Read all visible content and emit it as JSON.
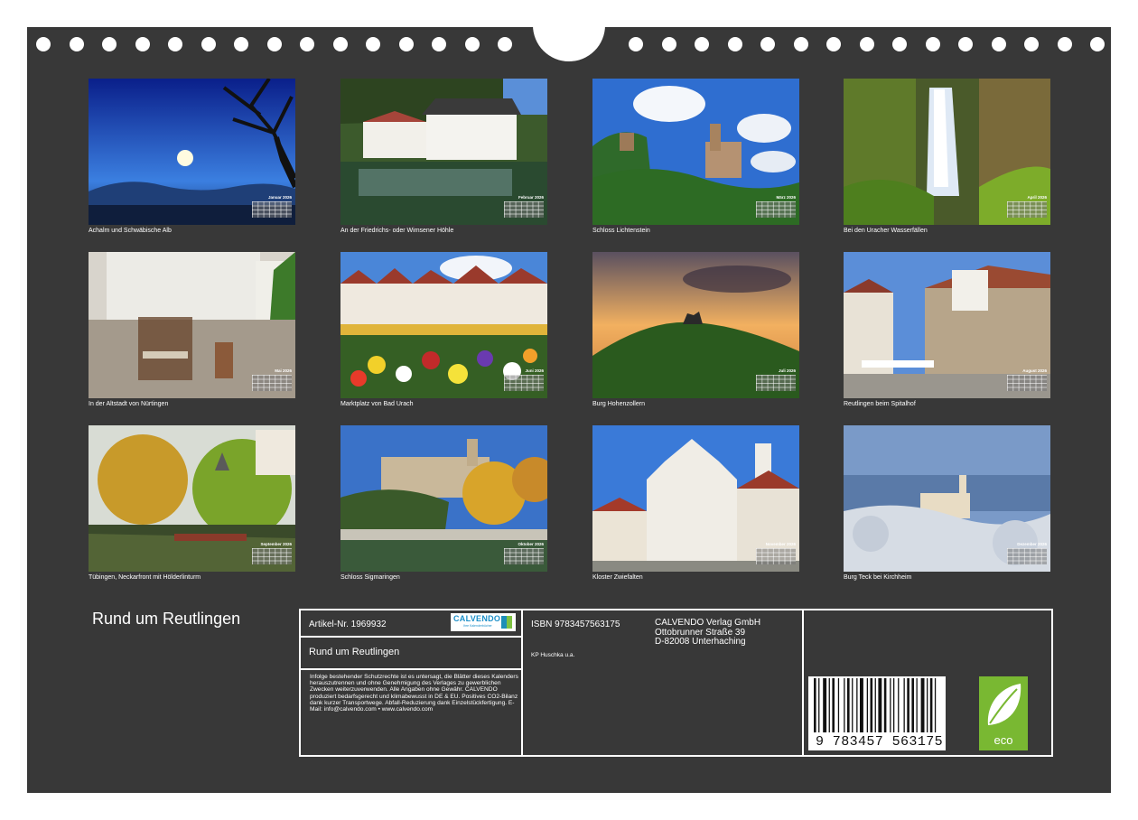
{
  "calendar": {
    "title": "Rund um Reutlingen",
    "months": [
      {
        "caption": "Achalm  und Schwäbische Alb",
        "month": "Januar 2026"
      },
      {
        "caption": "An der Friedrichs- oder Wimsener Höhle",
        "month": "Februar 2026"
      },
      {
        "caption": "Schloss Lichtenstein",
        "month": "März 2026"
      },
      {
        "caption": "Bei den Uracher Wasserfällen",
        "month": "April 2026"
      },
      {
        "caption": "In der Altstadt von Nürtingen",
        "month": "Mai 2026"
      },
      {
        "caption": "Marktplatz von Bad Urach",
        "month": "Juni 2026"
      },
      {
        "caption": "Burg Hohenzollern",
        "month": "Juli 2026"
      },
      {
        "caption": "Reutlingen beim Spitalhof",
        "month": "August 2026"
      },
      {
        "caption": "Tübingen, Neckarfront mit Hölderlinturm",
        "month": "September 2026"
      },
      {
        "caption": "Schloss Sigmaringen",
        "month": "Oktober 2026"
      },
      {
        "caption": "Kloster Zwiefalten",
        "month": "November 2026"
      },
      {
        "caption": "Burg Teck bei Kirchheim",
        "month": "Dezember 2026"
      }
    ]
  },
  "info": {
    "article": "Artikel-Nr. 1969932",
    "logo_word": "CALVENDO",
    "logo_sub": "Ihre Kalenderbücher",
    "title": "Rund um Reutlingen",
    "notice": "Infolge bestehender Schutzrechte ist es untersagt, die Blätter dieses Kalenders herauszutrennen und ohne Genehmigung des Verlages zu gewerblichen Zwecken weiterzuverwenden. Alle Angaben ohne Gewähr. CALVENDO produziert bedarfsgerecht und klimabewusst in DE & EU. Positives CO2-Bilanz dank kurzer Transportwege. Abfall-Reduzierung dank Einzelstückfertigung. E-Mail: info@calvendo.com • www.calvendo.com",
    "isbn": "ISBN 9783457563175",
    "author": "KP Huschka u.a.",
    "publisher": [
      "CALVENDO Verlag GmbH",
      "Ottobrunner Straße 39",
      "D-82008 Unterhaching"
    ],
    "barcode_number": "9 783457 563175",
    "eco_label": "eco"
  }
}
